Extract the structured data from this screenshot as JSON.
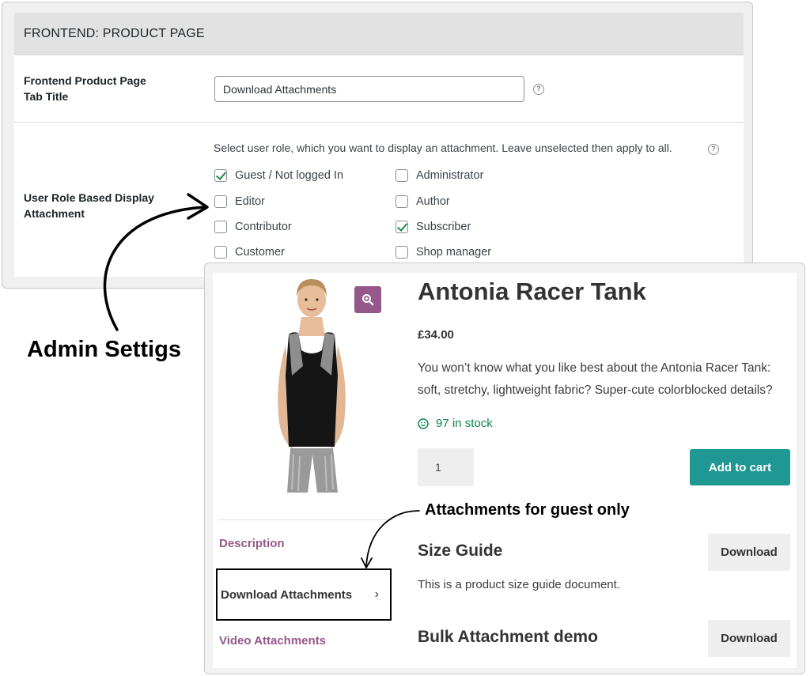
{
  "admin": {
    "section_title": "FRONTEND: PRODUCT PAGE",
    "tab_title": {
      "label_line1": "Frontend Product Page",
      "label_line2": "Tab Title",
      "value": "Download Attachments",
      "help": "?"
    },
    "role_display": {
      "label_line1": "User Role Based Display",
      "label_line2": "Attachment",
      "description": "Select user role, which you want to display an attachment. Leave unselected then apply to all.",
      "help": "?",
      "roles": [
        {
          "label": "Guest / Not logged In",
          "checked": true
        },
        {
          "label": "Administrator",
          "checked": false
        },
        {
          "label": "Editor",
          "checked": false
        },
        {
          "label": "Author",
          "checked": false
        },
        {
          "label": "Contributor",
          "checked": false
        },
        {
          "label": "Subscriber",
          "checked": true
        },
        {
          "label": "Customer",
          "checked": false
        },
        {
          "label": "Shop manager",
          "checked": false
        }
      ]
    }
  },
  "annotations": {
    "admin": "Admin Settigs",
    "guest": "Attachments for guest only"
  },
  "product": {
    "title": "Antonia Racer Tank",
    "price": "£34.00",
    "description": "You won’t know what you like best about the Antonia Racer Tank: soft, stretchy, lightweight fabric? Super-cute colorblocked details?",
    "stock": "97 in stock",
    "quantity": "1",
    "add_to_cart": "Add to cart",
    "zoom_icon": "magnifier-plus-icon",
    "accent_color": "#96588a",
    "button_color": "#1f9792",
    "tabs": {
      "description": "Description",
      "download": "Download Attachments",
      "download_chevron": "›",
      "video": "Video Attachments"
    },
    "attachments": [
      {
        "title": "Size Guide",
        "description": "This is a product size guide document.",
        "button": "Download"
      },
      {
        "title": "Bulk Attachment demo",
        "button": "Download"
      }
    ]
  }
}
